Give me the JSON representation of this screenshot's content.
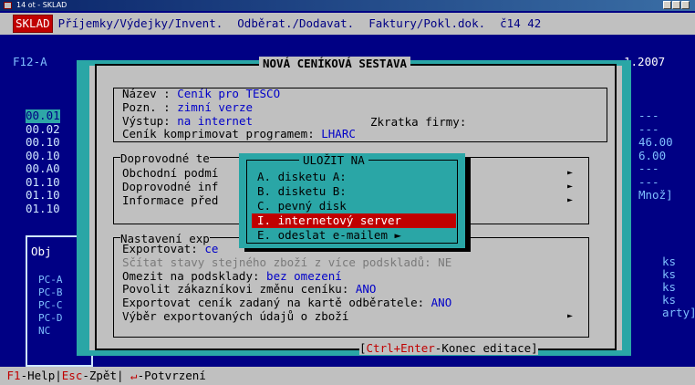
{
  "window": {
    "title": "14 ot - SKLAD"
  },
  "menu": {
    "items": [
      {
        "label": "SKLAD"
      },
      {
        "label": "Příjemky/Výdejky/Invent."
      },
      {
        "label": "Odběrat./Dodavat."
      },
      {
        "label": "Faktury/Pokl.dok."
      }
    ],
    "counter": "č14 42"
  },
  "background": {
    "f12_label": "F12-A",
    "date": "1.2007",
    "codes": [
      "00.01",
      "00.02",
      "00.10",
      "00.10",
      "00.A0",
      "01.10",
      "01.10",
      "01.10"
    ],
    "obj_label": "Obj",
    "obj_codes": [
      "PC-A",
      "PC-B",
      "PC-C",
      "PC-D",
      "NC"
    ],
    "right_codes": [
      "---",
      "---",
      "46.00",
      "6.00",
      "---",
      "---",
      "Množ]"
    ],
    "right_ks": [
      "ks",
      "ks",
      "ks",
      "ks",
      "arty]"
    ]
  },
  "dialog": {
    "title": "NOVÁ CENÍKOVÁ SESTAVA",
    "fields": [
      {
        "label": "Název : ",
        "value": "Ceník pro TESCO"
      },
      {
        "label": "Pozn. : ",
        "value": "zimní verze"
      },
      {
        "label": "Výstup: ",
        "value": "na internet"
      },
      {
        "label": "Ceník komprimovat programem: ",
        "value": "LHARC"
      }
    ],
    "zkratka_label": "Zkratka firmy:",
    "doprovodne_title": "Doprovodné te",
    "doprovodne_items": [
      "Obchodní podmí",
      "Doprovodné inf",
      "Informace před"
    ],
    "nastaveni_title": "Nastavení exp",
    "exportovat_label": "Exportovat: ",
    "exportovat_value": "ce",
    "scitat": "Sčítat stavy stejného zboží z více podskladů: NE",
    "omezit_label": "Omezit na podsklady: ",
    "omezit_value": "bez omezení",
    "povolit_label": "Povolit zákazníkovi změnu ceníku: ",
    "povolit_value": "ANO",
    "exportovat_cenik_label": "Exportovat ceník zadaný na kartě odběratele: ",
    "exportovat_cenik_value": "ANO",
    "vyber_label": "Výběr exportovaných údajů o zboží",
    "shortcut_key": "Ctrl+Enter",
    "shortcut_text": "-Konec editace"
  },
  "popup": {
    "title": "ULOŽIT NA",
    "items": [
      {
        "label": "A. disketu A:",
        "selected": false
      },
      {
        "label": "B. disketu B:",
        "selected": false
      },
      {
        "label": "C. pevný disk",
        "selected": false
      },
      {
        "label": "I. internetový server",
        "selected": true
      },
      {
        "label": "E. odeslat e-mailem ►",
        "selected": false
      }
    ]
  },
  "status": {
    "f1_key": "F1",
    "f1_text": "-Help",
    "esc_key": "Esc",
    "esc_text": "-Zpět",
    "enter_key": "↵",
    "enter_text": "-Potvrzení"
  }
}
